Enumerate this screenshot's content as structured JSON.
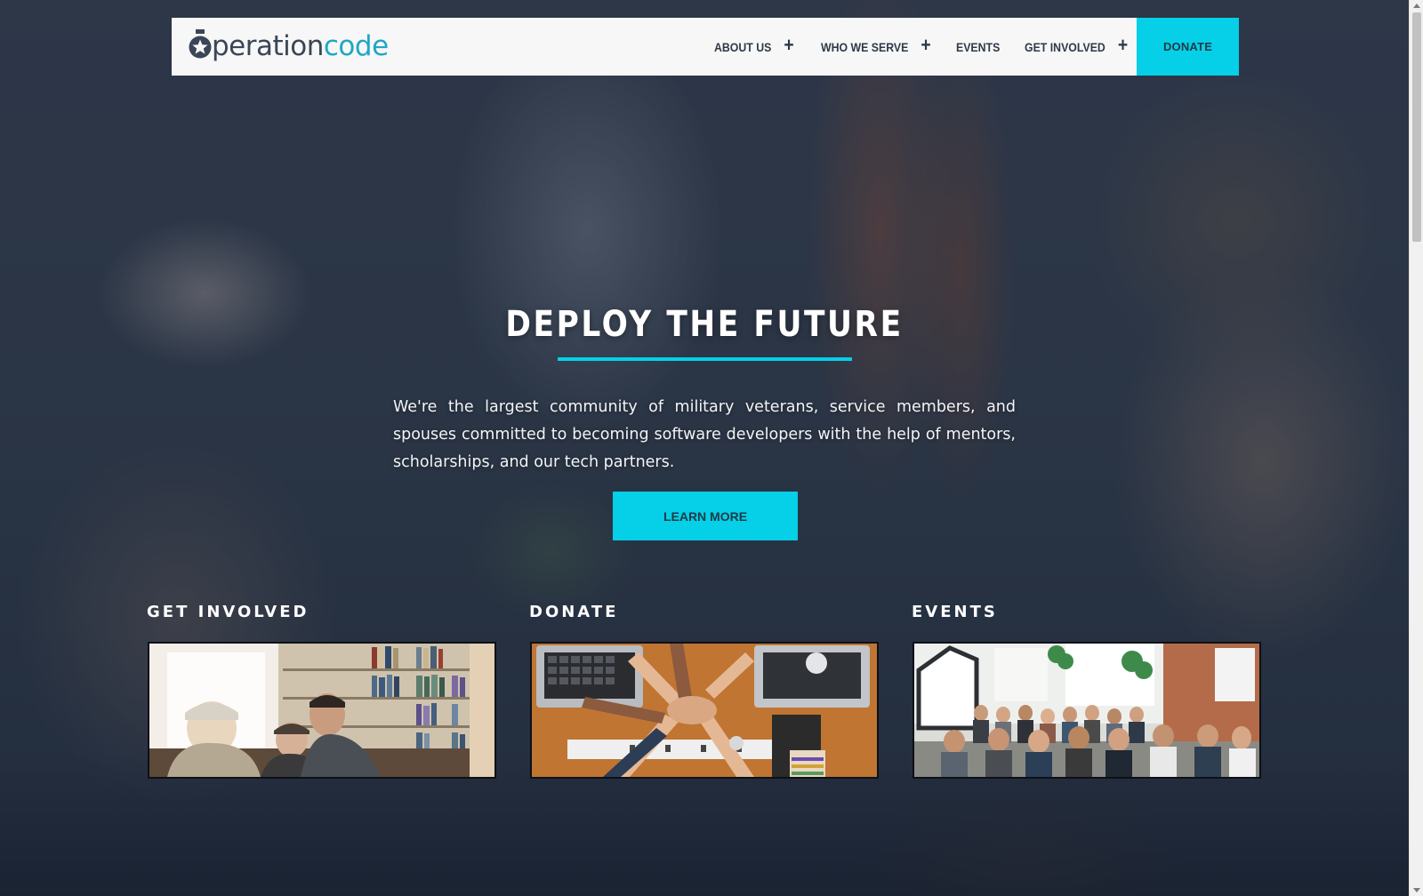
{
  "brand": {
    "logo_part1": "peration",
    "logo_part2": "code",
    "logo_alt": "operationcode"
  },
  "nav": {
    "items": [
      {
        "label": "ABOUT US",
        "has_submenu": true
      },
      {
        "label": "WHO WE SERVE",
        "has_submenu": true
      },
      {
        "label": "EVENTS",
        "has_submenu": false
      },
      {
        "label": "GET INVOLVED",
        "has_submenu": true
      }
    ],
    "plus_symbol": "+",
    "donate_label": "DONATE"
  },
  "hero": {
    "title": "DEPLOY THE FUTURE",
    "description": "We're the largest community of military veterans, service members, and spouses committed to becoming software developers with the help of mentors, scholarships, and our tech partners.",
    "cta_label": "LEARN MORE"
  },
  "cards": [
    {
      "title": "GET INVOLVED",
      "image": "people-collaborating-library"
    },
    {
      "title": "DONATE",
      "image": "team-fist-bump-over-laptops"
    },
    {
      "title": "EVENTS",
      "image": "audience-at-meetup"
    }
  ],
  "colors": {
    "accent": "#06cfe8",
    "logo_dark": "#3a4656",
    "logo_teal": "#1fa7c4",
    "nav_bg": "#f7f7f7",
    "nav_text": "#2f3a48"
  }
}
